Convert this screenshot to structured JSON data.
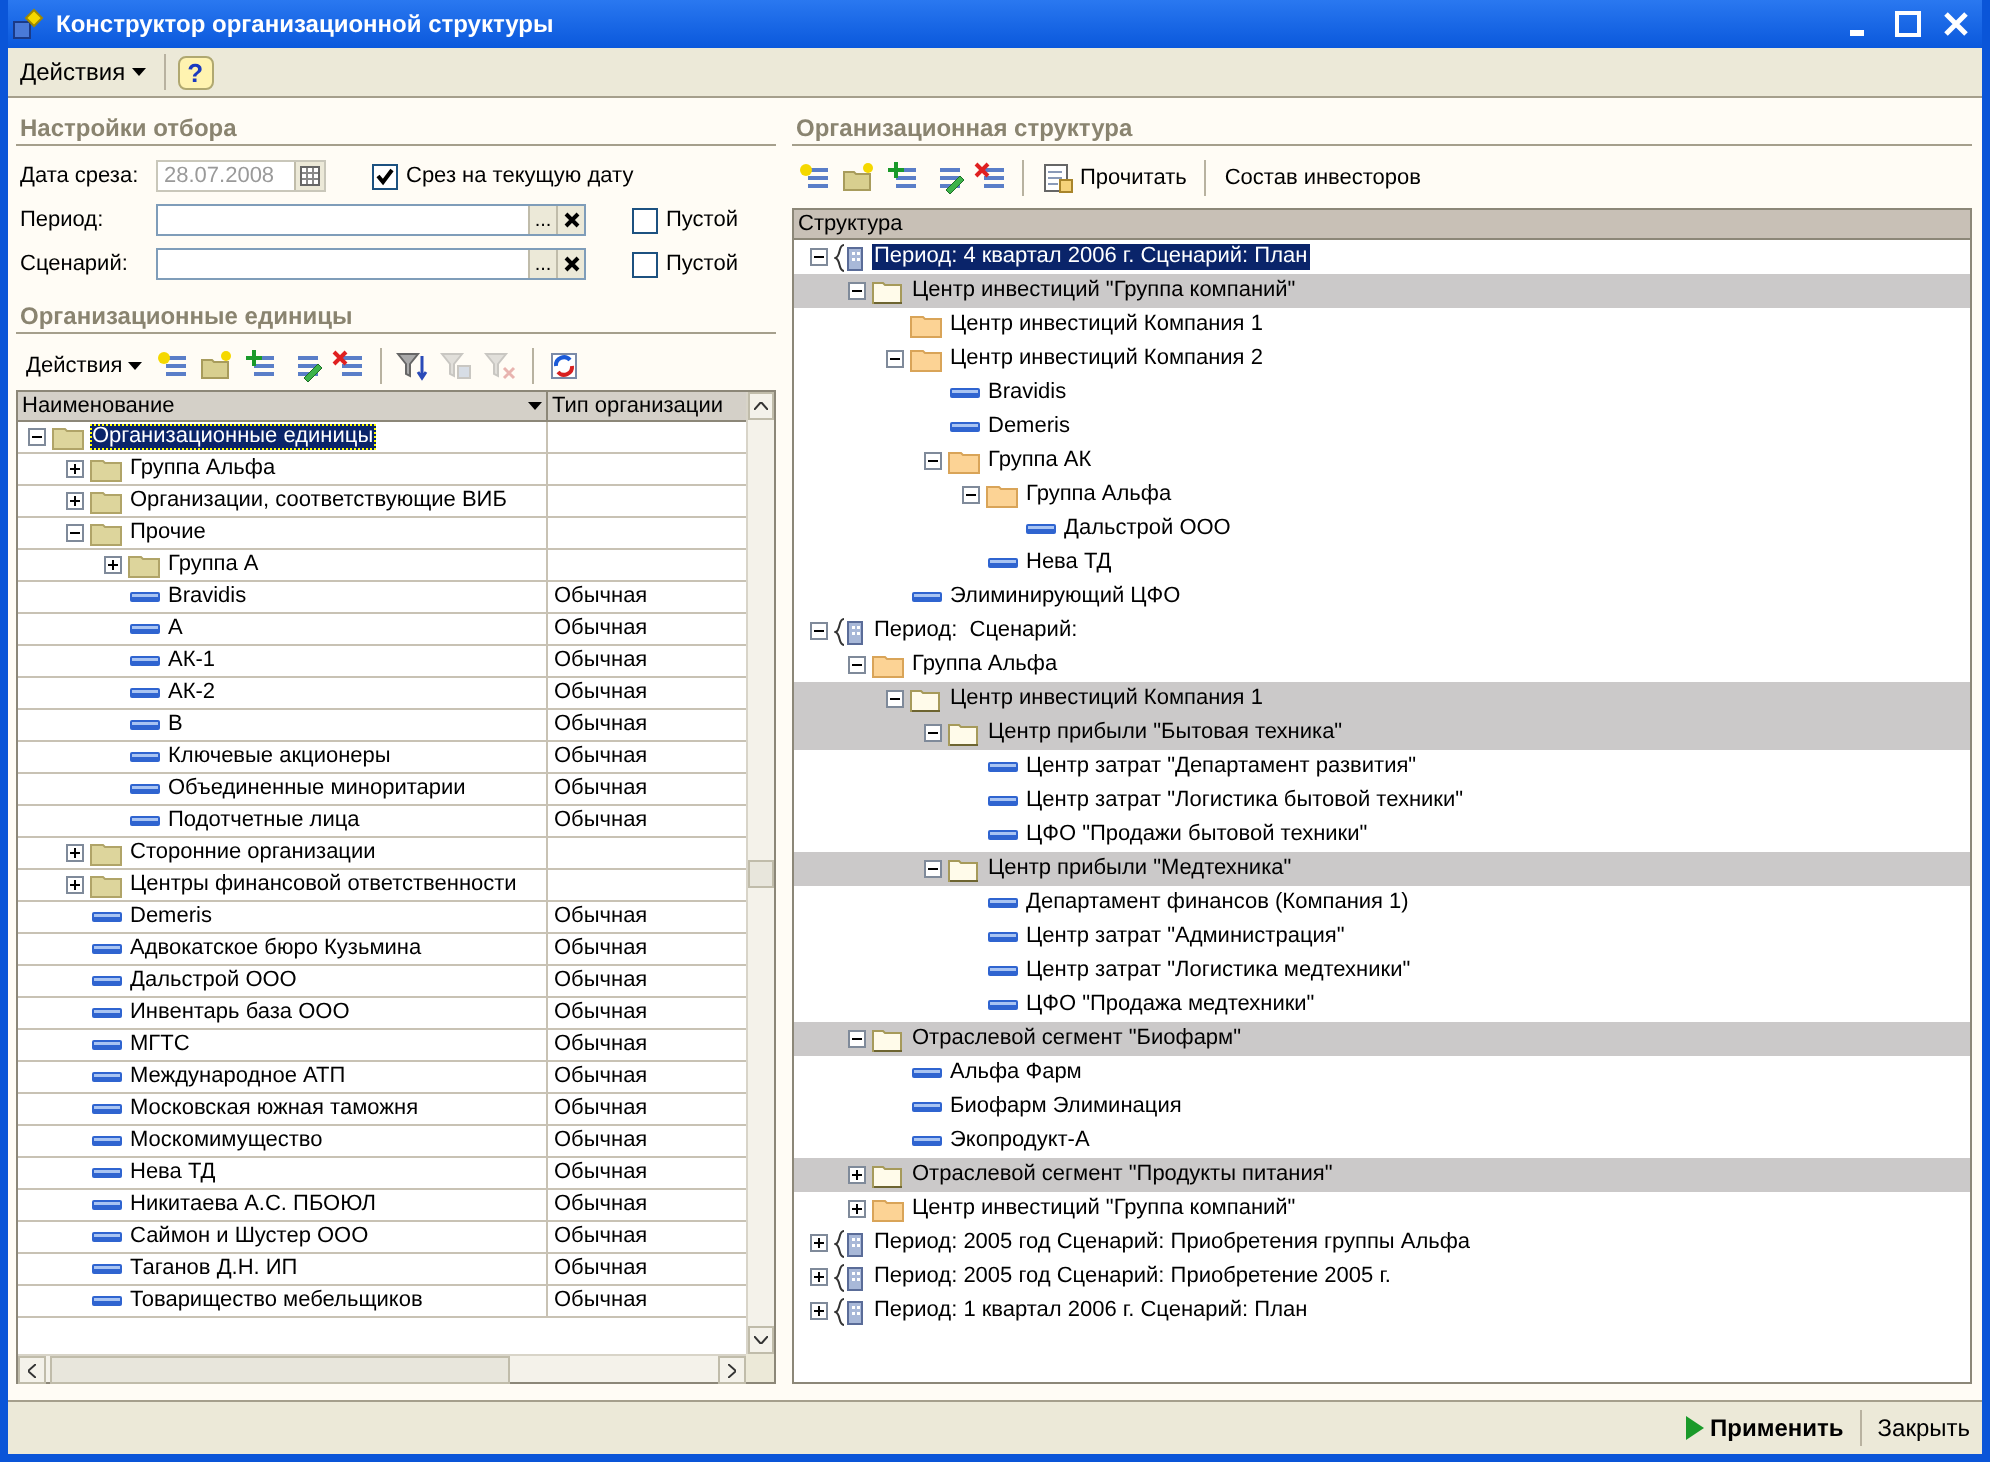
{
  "window": {
    "title": "Конструктор организационной структуры"
  },
  "menu": {
    "actions": "Действия",
    "help": "?"
  },
  "filter": {
    "title": "Настройки отбора",
    "date": {
      "label": "Дата среза:",
      "value": "28.07.2008",
      "disabled": true
    },
    "current_date": {
      "label": "Срез на текущую дату",
      "checked": true
    },
    "fields": [
      {
        "label": "Период:",
        "select": "...",
        "empty_label": "Пустой",
        "empty_checked": false
      },
      {
        "label": "Сценарий:",
        "select": "...",
        "empty_label": "Пустой",
        "empty_checked": false
      }
    ]
  },
  "org_units": {
    "title": "Организационные единицы",
    "actions": "Действия",
    "toolbar": [
      {
        "disabled": false
      },
      {
        "disabled": false
      },
      {
        "disabled": false
      },
      {
        "disabled": false
      },
      {
        "disabled": false
      },
      {
        "disabled": false
      },
      {
        "disabled": true
      },
      {
        "disabled": true
      },
      {
        "disabled": false
      }
    ],
    "columns": [
      "Наименование",
      "Тип организации"
    ],
    "tree": [
      {
        "label": "Организационные единицы",
        "kind": "folder",
        "expanded": true,
        "selected": true,
        "children": [
          {
            "label": "Группа Альфа",
            "kind": "folder",
            "expanded": false,
            "selected": false
          },
          {
            "label": "Организации, соответствующие ВИБ",
            "kind": "folder",
            "expanded": false,
            "selected": false
          },
          {
            "label": "Прочие",
            "kind": "folder",
            "expanded": true,
            "selected": false,
            "children": [
              {
                "label": "Группа А",
                "kind": "folder",
                "expanded": false,
                "selected": false
              },
              {
                "label": "Bravidis",
                "kind": "item",
                "type": "Обычная",
                "selected": false
              },
              {
                "label": "А",
                "kind": "item",
                "type": "Обычная",
                "selected": false
              },
              {
                "label": "АК-1",
                "kind": "item",
                "type": "Обычная",
                "selected": false
              },
              {
                "label": "АК-2",
                "kind": "item",
                "type": "Обычная",
                "selected": false
              },
              {
                "label": "В",
                "kind": "item",
                "type": "Обычная",
                "selected": false
              },
              {
                "label": "Ключевые акционеры",
                "kind": "item",
                "type": "Обычная",
                "selected": false
              },
              {
                "label": "Объединенные миноритарии",
                "kind": "item",
                "type": "Обычная",
                "selected": false
              },
              {
                "label": "Подотчетные лица",
                "kind": "item",
                "type": "Обычная",
                "selected": false
              }
            ]
          },
          {
            "label": "Сторонние организации",
            "kind": "folder",
            "expanded": false,
            "selected": false
          },
          {
            "label": "Центры финансовой ответственности",
            "kind": "folder",
            "expanded": false,
            "selected": false
          },
          {
            "label": "Demeris",
            "kind": "item",
            "type": "Обычная",
            "selected": false
          },
          {
            "label": "Адвокатское бюро Кузьмина",
            "kind": "item",
            "type": "Обычная",
            "selected": false
          },
          {
            "label": "Дальстрой ООО",
            "kind": "item",
            "type": "Обычная",
            "selected": false
          },
          {
            "label": "Инвентарь база ООО",
            "kind": "item",
            "type": "Обычная",
            "selected": false
          },
          {
            "label": "МГТС",
            "kind": "item",
            "type": "Обычная",
            "selected": false
          },
          {
            "label": "Международное АТП",
            "kind": "item",
            "type": "Обычная",
            "selected": false
          },
          {
            "label": "Московская южная таможня",
            "kind": "item",
            "type": "Обычная",
            "selected": false
          },
          {
            "label": "Москомимущество",
            "kind": "item",
            "type": "Обычная",
            "selected": false
          },
          {
            "label": "Нева ТД",
            "kind": "item",
            "type": "Обычная",
            "selected": false
          },
          {
            "label": "Никитаева А.С. ПБОЮЛ",
            "kind": "item",
            "type": "Обычная",
            "selected": false
          },
          {
            "label": "Саймон и Шустер ООО",
            "kind": "item",
            "type": "Обычная",
            "selected": false
          },
          {
            "label": "Таганов Д.Н. ИП",
            "kind": "item",
            "type": "Обычная",
            "selected": false
          },
          {
            "label": "Товарищество мебельщиков",
            "kind": "item",
            "type": "Обычная",
            "selected": false
          }
        ]
      }
    ]
  },
  "structure": {
    "title": "Организационная структура",
    "read_button": "Прочитать",
    "investors_button": "Состав инвесторов",
    "column": "Структура",
    "tree": [
      {
        "label": "Период: 4 квартал 2006 г. Сценарий: План",
        "kind": "period",
        "expanded": true,
        "selected": true,
        "children": [
          {
            "label": "Центр инвестиций \"Группа компаний\"",
            "kind": "center",
            "expanded": true,
            "selected": false,
            "children": [
              {
                "label": "Центр инвестиций Компания 1",
                "kind": "folder",
                "selected": false
              },
              {
                "label": "Центр инвестиций Компания 2",
                "kind": "folder",
                "expanded": true,
                "selected": false,
                "children": [
                  {
                    "label": "Bravidis",
                    "kind": "item",
                    "selected": false
                  },
                  {
                    "label": "Demeris",
                    "kind": "item",
                    "selected": false
                  },
                  {
                    "label": "Группа АК",
                    "kind": "folder",
                    "expanded": true,
                    "selected": false,
                    "children": [
                      {
                        "label": "Группа Альфа",
                        "kind": "folder",
                        "expanded": true,
                        "selected": false,
                        "children": [
                          {
                            "label": "Дальстрой ООО",
                            "kind": "item",
                            "selected": false
                          }
                        ]
                      },
                      {
                        "label": "Нева ТД",
                        "kind": "item",
                        "selected": false
                      }
                    ]
                  }
                ]
              },
              {
                "label": "Элиминирующий ЦФО",
                "kind": "item",
                "selected": false
              }
            ]
          }
        ]
      },
      {
        "label": "Период:  Сценарий:",
        "kind": "period",
        "expanded": true,
        "selected": false,
        "children": [
          {
            "label": "Группа Альфа",
            "kind": "folder",
            "expanded": true,
            "selected": false,
            "children": [
              {
                "label": "Центр инвестиций Компания 1",
                "kind": "center",
                "expanded": true,
                "selected": false,
                "children": [
                  {
                    "label": "Центр прибыли \"Бытовая техника\"",
                    "kind": "center",
                    "expanded": true,
                    "selected": false,
                    "children": [
                      {
                        "label": "Центр затрат \"Департамент развития\"",
                        "kind": "item",
                        "selected": false
                      },
                      {
                        "label": "Центр затрат \"Логистика бытовой техники\"",
                        "kind": "item",
                        "selected": false
                      },
                      {
                        "label": "ЦФО \"Продажи бытовой техники\"",
                        "kind": "item",
                        "selected": false
                      }
                    ]
                  },
                  {
                    "label": "Центр прибыли \"Медтехника\"",
                    "kind": "center",
                    "expanded": true,
                    "selected": false,
                    "children": [
                      {
                        "label": "Департамент финансов (Компания 1)",
                        "kind": "item",
                        "selected": false
                      },
                      {
                        "label": "Центр затрат \"Администрация\"",
                        "kind": "item",
                        "selected": false
                      },
                      {
                        "label": "Центр затрат \"Логистика медтехники\"",
                        "kind": "item",
                        "selected": false
                      },
                      {
                        "label": "ЦФО \"Продажа медтехники\"",
                        "kind": "item",
                        "selected": false
                      }
                    ]
                  }
                ]
              }
            ]
          },
          {
            "label": "Отраслевой сегмент \"Биофарм\"",
            "kind": "center",
            "expanded": true,
            "selected": false,
            "children": [
              {
                "label": "Альфа Фарм",
                "kind": "item",
                "selected": false
              },
              {
                "label": "Биофарм Элиминация",
                "kind": "item",
                "selected": false
              },
              {
                "label": "Экопродукт-А",
                "kind": "item",
                "selected": false
              }
            ]
          },
          {
            "label": "Отраслевой сегмент \"Продукты питания\"",
            "kind": "center",
            "expanded": false,
            "selected": false
          },
          {
            "label": "Центр инвестиций \"Группа компаний\"",
            "kind": "folder",
            "expanded": false,
            "selected": false
          }
        ]
      },
      {
        "label": "Период: 2005 год Сценарий: Приобретения группы Альфа",
        "kind": "period",
        "expanded": false,
        "selected": false
      },
      {
        "label": "Период: 2005 год Сценарий: Приобретение 2005 г.",
        "kind": "period",
        "expanded": false,
        "selected": false
      },
      {
        "label": "Период: 1 квартал 2006 г. Сценарий: План",
        "kind": "period",
        "expanded": false,
        "selected": false
      }
    ]
  },
  "footer": {
    "apply": "Применить",
    "close": "Закрыть"
  }
}
